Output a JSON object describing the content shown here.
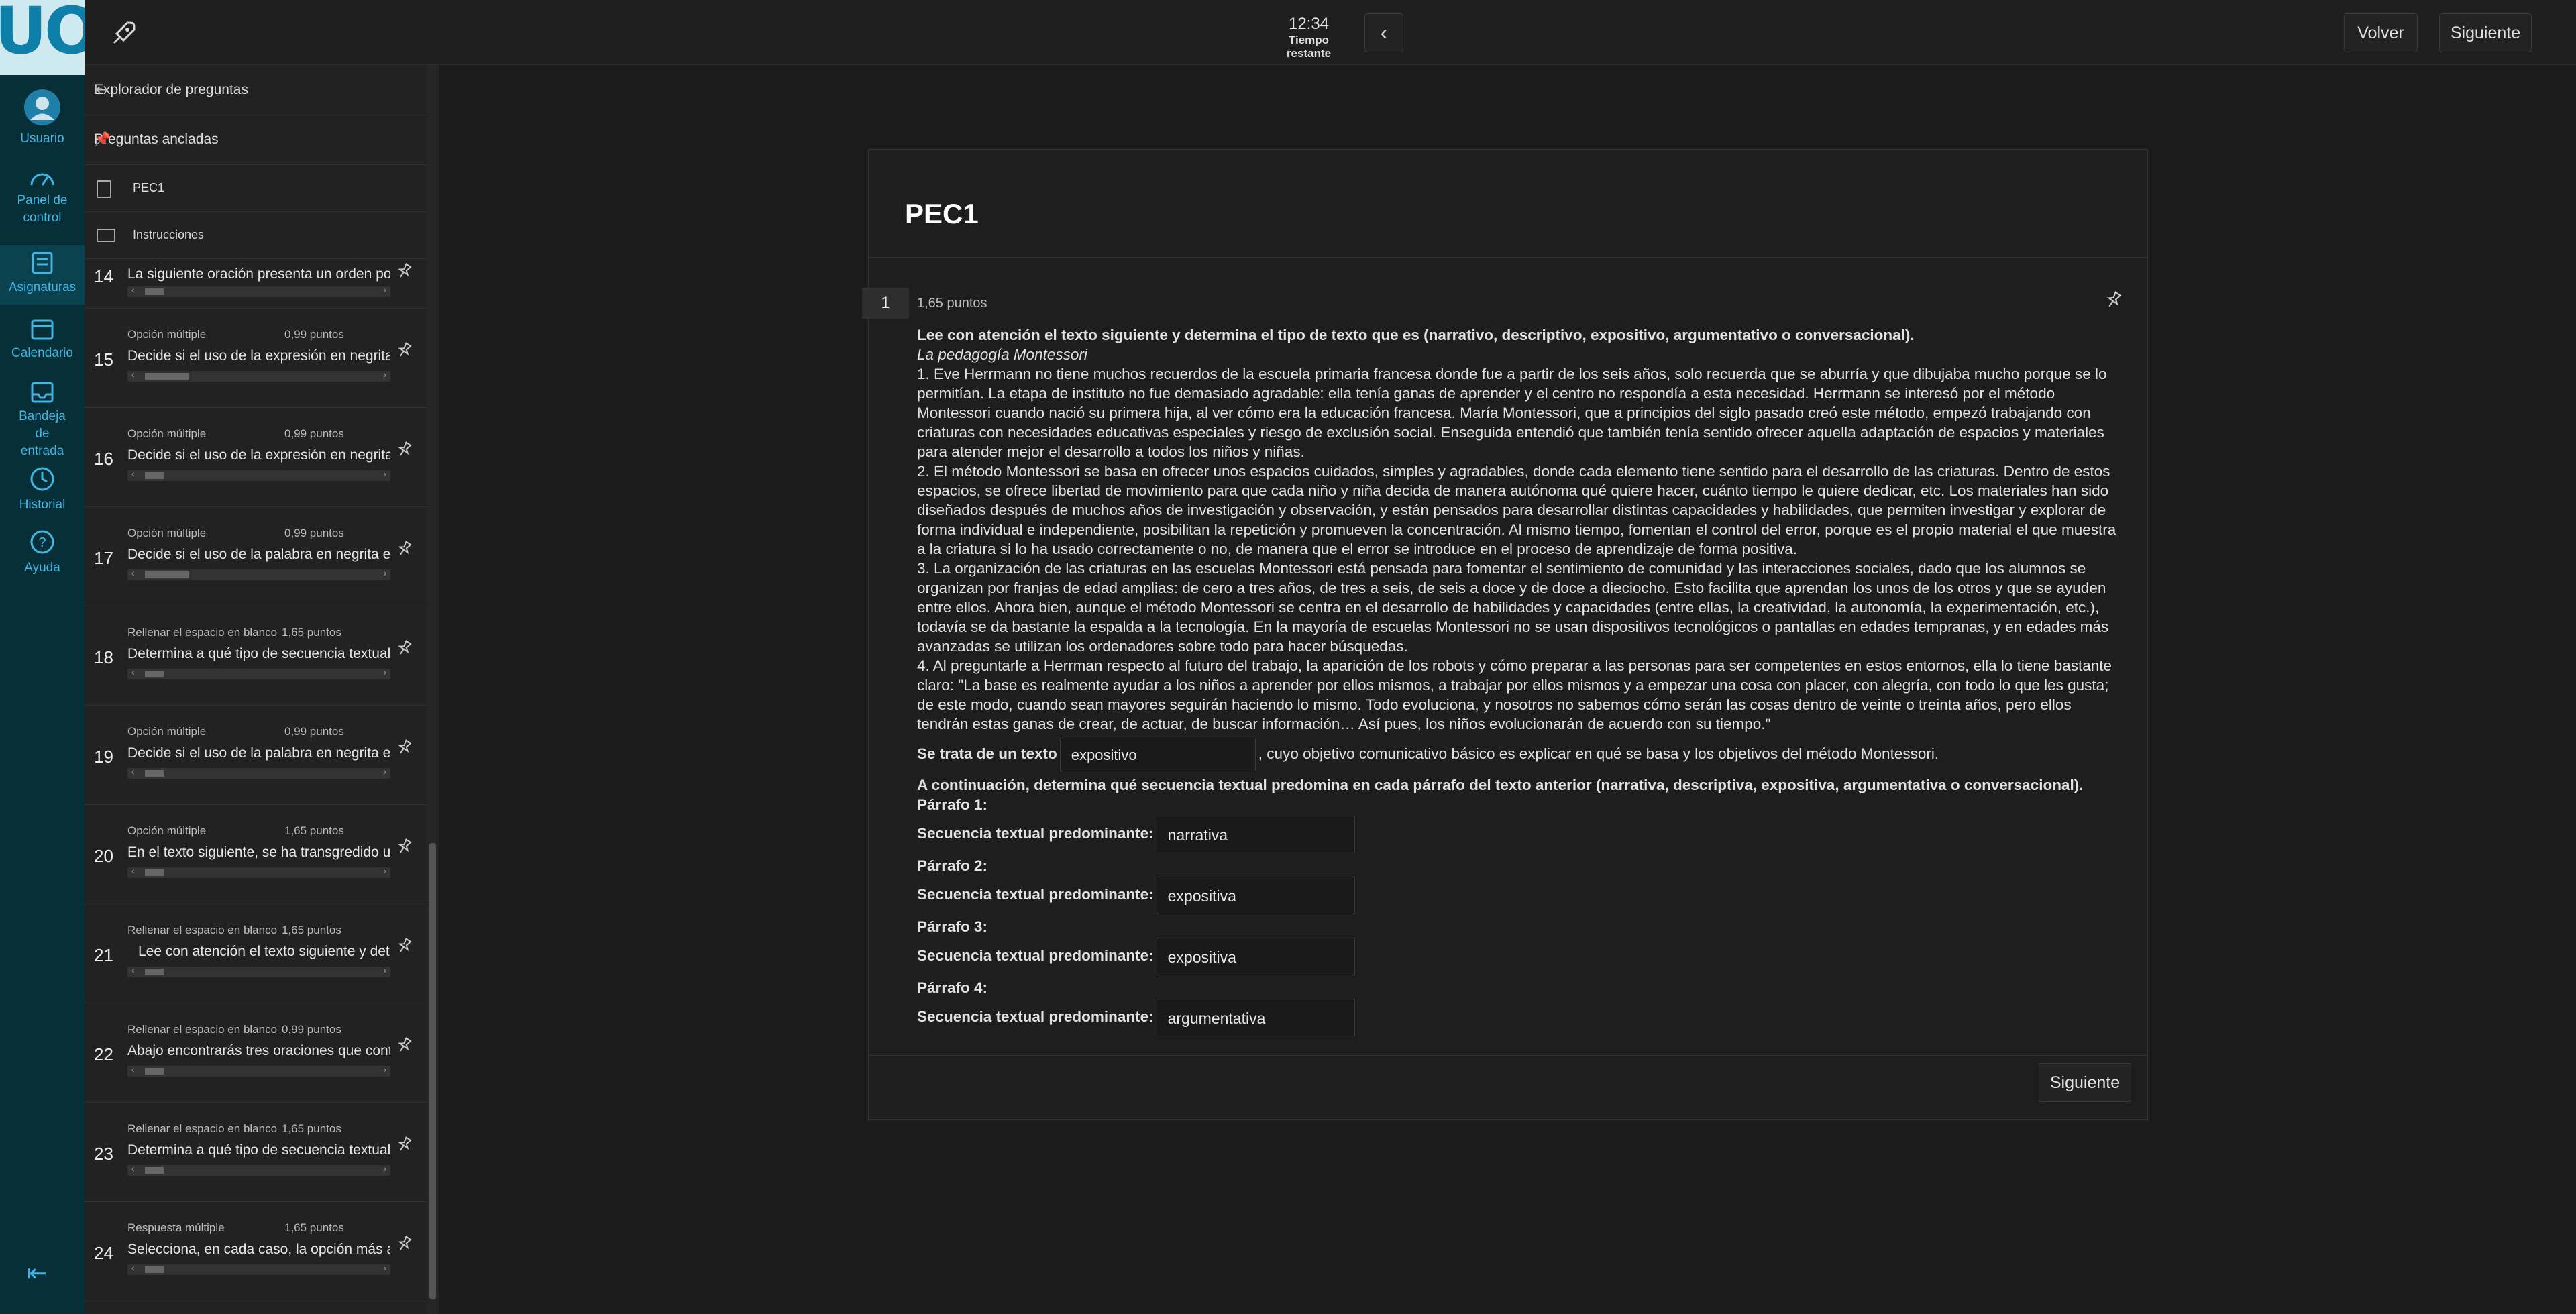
{
  "logo_text": "UOC",
  "rail": [
    {
      "label": "Usuario",
      "icon": "user-avatar-icon"
    },
    {
      "label": "Panel de control",
      "icon": "dashboard-icon"
    },
    {
      "label": "Asignaturas",
      "icon": "subjects-icon"
    },
    {
      "label": "Calendario",
      "icon": "calendar-icon"
    },
    {
      "label": "Bandeja de entrada",
      "icon": "inbox-icon"
    },
    {
      "label": "Historial",
      "icon": "history-icon"
    },
    {
      "label": "Ayuda",
      "icon": "help-icon"
    }
  ],
  "topbar": {
    "time": "12:34",
    "time_label": "Tiempo restante",
    "back_label": "Volver",
    "next_label": "Siguiente"
  },
  "panel": {
    "title": "Explorador de preguntas",
    "pinned_title": "Preguntas ancladas",
    "pec_label": "PEC1",
    "instructions_label": "Instrucciones",
    "questions": [
      {
        "num": "14",
        "type": "",
        "points": "",
        "text": "La siguiente oración presenta un orden poco habitual"
      },
      {
        "num": "15",
        "type": "Opción múltiple",
        "points": "0,99 puntos",
        "text": "Decide si el uso de la expresión en negrita es"
      },
      {
        "num": "16",
        "type": "Opción múltiple",
        "points": "0,99 puntos",
        "text": "Decide si el uso de la expresión en negrita es"
      },
      {
        "num": "17",
        "type": "Opción múltiple",
        "points": "0,99 puntos",
        "text": "Decide si el uso de la palabra en negrita es co"
      },
      {
        "num": "18",
        "type": "Rellenar el espacio en blanco",
        "points": "1,65 puntos",
        "text": "Determina a qué tipo de secuencia textual pe"
      },
      {
        "num": "19",
        "type": "Opción múltiple",
        "points": "0,99 puntos",
        "text": "Decide si el uso de la palabra en negrita es co"
      },
      {
        "num": "20",
        "type": "Opción múltiple",
        "points": "1,65 puntos",
        "text": "En el texto siguiente, se ha transgredido una"
      },
      {
        "num": "21",
        "type": "Rellenar el espacio en blanco",
        "points": "1,65 puntos",
        "text": "Lee con atención el texto siguiente y deter"
      },
      {
        "num": "22",
        "type": "Rellenar el espacio en blanco",
        "points": "0,99 puntos",
        "text": "Abajo encontrarás tres oraciones que conti"
      },
      {
        "num": "23",
        "type": "Rellenar el espacio en blanco",
        "points": "1,65 puntos",
        "text": "Determina a qué tipo de secuencia textual p"
      },
      {
        "num": "24",
        "type": "Respuesta múltiple",
        "points": "1,65 puntos",
        "text": "Selecciona, en cada caso, la opción más adec"
      }
    ]
  },
  "main": {
    "title": "PEC1",
    "question_number": "1",
    "question_points": "1,65 puntos",
    "instruction": "Lee con atención el texto siguiente y determina el tipo de texto que es (narrativo, descriptivo, expositivo, argumentativo o conversacional).",
    "text_title": "La pedagogía Montessori",
    "paragraphs": [
      "1.     Eve Herrmann no tiene muchos recuerdos de la escuela primaria francesa donde fue a partir de los seis años, solo recuerda que se aburría y que dibujaba mucho porque se lo permitían. La etapa de instituto no fue demasiado agradable: ella tenía ganas de aprender y el centro no respondía a esta necesidad. Herrmann se interesó por el método Montessori cuando nació su primera hija, al ver cómo era la educación francesa. María Montessori, que a principios del siglo pasado creó este método, empezó trabajando con criaturas con necesidades educativas especiales y riesgo de exclusión social. Enseguida entendió que también tenía sentido ofrecer aquella adaptación de espacios y materiales para atender mejor el desarrollo a todos los niños y niñas.",
      "2.     El método Montessori se basa en ofrecer unos espacios cuidados, simples y agradables, donde cada elemento tiene sentido para el desarrollo de las criaturas. Dentro de estos espacios, se ofrece libertad de movimiento para que cada niño y niña decida de manera autónoma qué quiere hacer, cuánto tiempo le quiere dedicar, etc. Los materiales han sido diseñados después de muchos años de investigación y observación, y están pensados para desarrollar distintas capacidades y habilidades, que permiten investigar y explorar de forma individual e independiente, posibilitan la repetición y promueven la concentración. Al mismo tiempo, fomentan el control del error, porque es el propio material el que muestra a la criatura si lo ha usado correctamente o no, de manera que el error se introduce en el proceso de aprendizaje de forma positiva.",
      "3.     La organización de las criaturas en las escuelas Montessori está pensada para fomentar el sentimiento de comunidad y las interacciones sociales, dado que los alumnos se organizan por franjas de edad amplias: de cero a tres años, de tres a seis, de seis a doce y de doce a dieciocho. Esto facilita que aprendan los unos de los otros y que se ayuden entre ellos. Ahora bien, aunque el método Montessori se centra en el desarrollo de habilidades y capacidades (entre ellas, la creatividad, la autonomía, la experimentación, etc.), todavía se da bastante la espalda a la tecnología. En la mayoría de escuelas Montessori no se usan dispositivos tecnológicos o pantallas en edades tempranas, y en edades más avanzadas se utilizan los ordenadores sobre todo para hacer búsquedas.",
      "4.     Al preguntarle a Herrman respecto al futuro del trabajo, la aparición de los robots y cómo preparar a las personas para ser competentes en estos entornos, ella lo tiene bastante claro: \"La base es realmente ayudar a los niños a aprender por ellos mismos, a trabajar por ellos mismos y a empezar una cosa con placer, con alegría, con todo lo que les gusta; de este modo, cuando sean mayores seguirán haciendo lo mismo. Todo evoluciona, y nosotros no sabemos cómo serán las cosas dentro de veinte o treinta años, pero ellos tendrán estas ganas de crear, de actuar, de buscar información… Así pues, los niños evolucionarán de acuerdo con su tiempo.\""
    ],
    "fill_prefix": "Se trata de un texto",
    "fill_value": "expositivo",
    "fill_suffix": ", cuyo objetivo comunicativo básico es explicar en qué se basa y los objetivos del método Montessori.",
    "second_instruction": "A continuación, determina qué secuencia textual predomina en cada párrafo del texto anterior (narrativa, descriptiva, expositiva, argumentativa o conversacional).",
    "seq_label": "Secuencia textual predominante:",
    "sequences": [
      {
        "para": "Párrafo 1:",
        "value": "narrativa"
      },
      {
        "para": "Párrafo 2:",
        "value": "expositiva"
      },
      {
        "para": "Párrafo 3:",
        "value": "expositiva"
      },
      {
        "para": "Párrafo 4:",
        "value": "argumentativa"
      }
    ],
    "next_label": "Siguiente"
  }
}
